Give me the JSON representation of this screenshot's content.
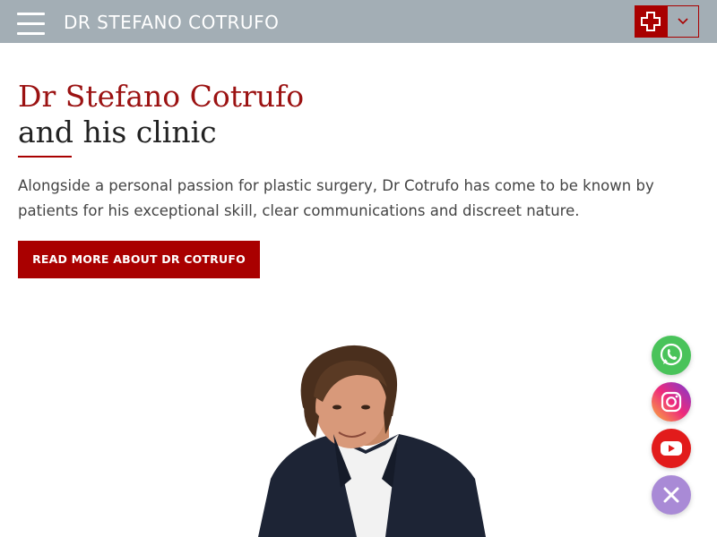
{
  "header": {
    "brand": "DR STEFANO COTRUFO",
    "menu_icon": "hamburger-menu-icon",
    "medical_icon": "medical-cross-icon",
    "dropdown_icon": "chevron-down-icon"
  },
  "main": {
    "title_line1": "Dr Stefano Cotrufo",
    "title_line2": "and his clinic",
    "intro": "Alongside a personal passion for plastic surgery, Dr Cotrufo has come to be known by patients for his exceptional skill, clear communications and discreet nature.",
    "cta_label": "READ MORE ABOUT DR COTRUFO"
  },
  "social": [
    {
      "icon": "whatsapp-icon",
      "color": "#49c35a"
    },
    {
      "icon": "instagram-icon",
      "color": "#ee2a7b"
    },
    {
      "icon": "youtube-icon",
      "color": "#e21b1b"
    },
    {
      "icon": "close-icon",
      "color": "#a98ad6"
    }
  ],
  "colors": {
    "header_bg": "#a3aeb5",
    "accent": "#a90000",
    "title_red": "#9b1212"
  }
}
